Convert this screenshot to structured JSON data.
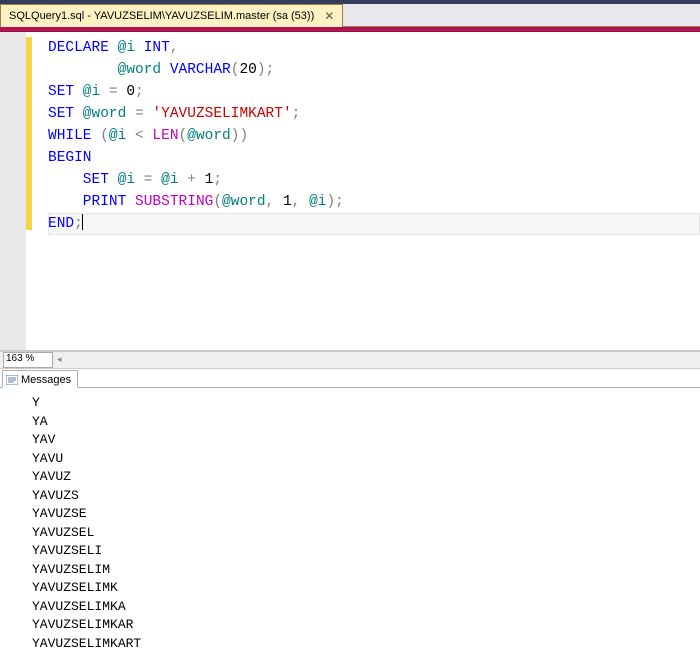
{
  "tab": {
    "title": "SQLQuery1.sql - YAVUZSELIM\\YAVUZSELIM.master (sa (53))",
    "close": "✕"
  },
  "code": {
    "l1a": "DECLARE",
    "l1b": " @i ",
    "l1c": "INT",
    "l1d": ",",
    "l2a": "        @word ",
    "l2b": "VARCHAR",
    "l2c": "(",
    "l2d": "20",
    "l2e": ");",
    "l3a": "SET",
    "l3b": " @i ",
    "l3c": "=",
    "l3d": " 0",
    "l3e": ";",
    "l4a": "SET",
    "l4b": " @word ",
    "l4c": "=",
    "l4d": " 'YAVUZSELIMKART'",
    "l4e": ";",
    "l5a": "WHILE",
    "l5b": " (",
    "l5c": "@i ",
    "l5d": "<",
    "l5e": " LEN",
    "l5f": "(",
    "l5g": "@word",
    "l5h": "))",
    "l6a": "BEGIN",
    "l7a": "    SET",
    "l7b": " @i ",
    "l7c": "=",
    "l7d": " @i ",
    "l7e": "+",
    "l7f": " 1",
    "l7g": ";",
    "l8a": "    PRINT",
    "l8b": " SUBSTRING",
    "l8c": "(",
    "l8d": "@word",
    "l8e": ",",
    "l8f": " 1",
    "l8g": ",",
    "l8h": " @i",
    "l8i": ");",
    "l9a": "END",
    "l9b": ";"
  },
  "zoom": {
    "value": "163 %"
  },
  "messagesTab": {
    "label": "Messages"
  },
  "messages": {
    "m1": "Y",
    "m2": "YA",
    "m3": "YAV",
    "m4": "YAVU",
    "m5": "YAVUZ",
    "m6": "YAVUZS",
    "m7": "YAVUZSE",
    "m8": "YAVUZSEL",
    "m9": "YAVUZSELI",
    "m10": "YAVUZSELIM",
    "m11": "YAVUZSELIMK",
    "m12": "YAVUZSELIMKA",
    "m13": "YAVUZSELIMKAR",
    "m14": "YAVUZSELIMKART"
  }
}
